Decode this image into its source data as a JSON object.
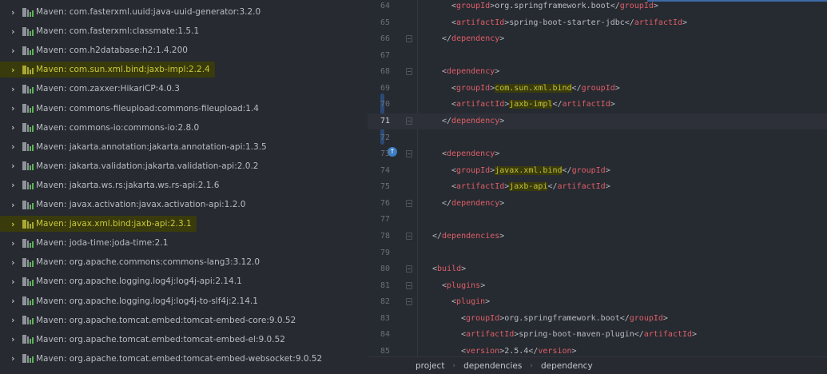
{
  "project_tree": {
    "items": [
      {
        "label": "Maven: com.fasterxml.uuid:java-uuid-generator:3.2.0",
        "highlighted": false
      },
      {
        "label": "Maven: com.fasterxml:classmate:1.5.1",
        "highlighted": false
      },
      {
        "label": "Maven: com.h2database:h2:1.4.200",
        "highlighted": false
      },
      {
        "label": "Maven: com.sun.xml.bind:jaxb-impl:2.2.4",
        "highlighted": true
      },
      {
        "label": "Maven: com.zaxxer:HikariCP:4.0.3",
        "highlighted": false
      },
      {
        "label": "Maven: commons-fileupload:commons-fileupload:1.4",
        "highlighted": false
      },
      {
        "label": "Maven: commons-io:commons-io:2.8.0",
        "highlighted": false
      },
      {
        "label": "Maven: jakarta.annotation:jakarta.annotation-api:1.3.5",
        "highlighted": false
      },
      {
        "label": "Maven: jakarta.validation:jakarta.validation-api:2.0.2",
        "highlighted": false
      },
      {
        "label": "Maven: jakarta.ws.rs:jakarta.ws.rs-api:2.1.6",
        "highlighted": false
      },
      {
        "label": "Maven: javax.activation:javax.activation-api:1.2.0",
        "highlighted": false
      },
      {
        "label": "Maven: javax.xml.bind:jaxb-api:2.3.1",
        "highlighted": true
      },
      {
        "label": "Maven: joda-time:joda-time:2.1",
        "highlighted": false
      },
      {
        "label": "Maven: org.apache.commons:commons-lang3:3.12.0",
        "highlighted": false
      },
      {
        "label": "Maven: org.apache.logging.log4j:log4j-api:2.14.1",
        "highlighted": false
      },
      {
        "label": "Maven: org.apache.logging.log4j:log4j-to-slf4j:2.14.1",
        "highlighted": false
      },
      {
        "label": "Maven: org.apache.tomcat.embed:tomcat-embed-core:9.0.52",
        "highlighted": false
      },
      {
        "label": "Maven: org.apache.tomcat.embed:tomcat-embed-el:9.0.52",
        "highlighted": false
      },
      {
        "label": "Maven: org.apache.tomcat.embed:tomcat-embed-websocket:9.0.52",
        "highlighted": false
      }
    ]
  },
  "editor": {
    "current_line": 71,
    "lines": [
      {
        "n": "64",
        "indent": 3,
        "fold": false,
        "seg": [
          [
            "p",
            "<"
          ],
          [
            "n",
            "groupId"
          ],
          [
            "p",
            ">"
          ],
          [
            "x",
            "org.springframework.boot"
          ],
          [
            "p",
            "</"
          ],
          [
            "n",
            "groupId"
          ],
          [
            "p",
            ">"
          ]
        ]
      },
      {
        "n": "65",
        "indent": 3,
        "fold": false,
        "seg": [
          [
            "p",
            "<"
          ],
          [
            "n",
            "artifactId"
          ],
          [
            "p",
            ">"
          ],
          [
            "x",
            "spring-boot-starter-jdbc"
          ],
          [
            "p",
            "</"
          ],
          [
            "n",
            "artifactId"
          ],
          [
            "p",
            ">"
          ]
        ]
      },
      {
        "n": "66",
        "indent": 2,
        "fold": true,
        "seg": [
          [
            "p",
            "</"
          ],
          [
            "n",
            "dependency"
          ],
          [
            "p",
            ">"
          ]
        ]
      },
      {
        "n": "67",
        "indent": 0,
        "fold": false,
        "seg": []
      },
      {
        "n": "68",
        "indent": 2,
        "fold": true,
        "seg": [
          [
            "p",
            "<"
          ],
          [
            "n",
            "dependency"
          ],
          [
            "p",
            ">"
          ]
        ]
      },
      {
        "n": "69",
        "indent": 3,
        "fold": false,
        "seg": [
          [
            "p",
            "<"
          ],
          [
            "n",
            "groupId"
          ],
          [
            "p",
            ">"
          ],
          [
            "h",
            "com.sun.xml.bind"
          ],
          [
            "p",
            "</"
          ],
          [
            "n",
            "groupId"
          ],
          [
            "p",
            ">"
          ]
        ]
      },
      {
        "n": "70",
        "indent": 3,
        "fold": false,
        "seg": [
          [
            "p",
            "<"
          ],
          [
            "n",
            "artifactId"
          ],
          [
            "p",
            ">"
          ],
          [
            "h",
            "jaxb-impl"
          ],
          [
            "p",
            "</"
          ],
          [
            "n",
            "artifactId"
          ],
          [
            "p",
            ">"
          ]
        ]
      },
      {
        "n": "71",
        "indent": 2,
        "fold": true,
        "seg": [
          [
            "p",
            "</"
          ],
          [
            "n",
            "dependency"
          ],
          [
            "p",
            ">"
          ]
        ]
      },
      {
        "n": "72",
        "indent": 0,
        "fold": false,
        "seg": []
      },
      {
        "n": "73",
        "indent": 2,
        "fold": true,
        "seg": [
          [
            "p",
            "<"
          ],
          [
            "n",
            "dependency"
          ],
          [
            "p",
            ">"
          ]
        ]
      },
      {
        "n": "74",
        "indent": 3,
        "fold": false,
        "seg": [
          [
            "p",
            "<"
          ],
          [
            "n",
            "groupId"
          ],
          [
            "p",
            ">"
          ],
          [
            "h",
            "javax.xml.bind"
          ],
          [
            "p",
            "</"
          ],
          [
            "n",
            "groupId"
          ],
          [
            "p",
            ">"
          ]
        ]
      },
      {
        "n": "75",
        "indent": 3,
        "fold": false,
        "seg": [
          [
            "p",
            "<"
          ],
          [
            "n",
            "artifactId"
          ],
          [
            "p",
            ">"
          ],
          [
            "h",
            "jaxb-api"
          ],
          [
            "p",
            "</"
          ],
          [
            "n",
            "artifactId"
          ],
          [
            "p",
            ">"
          ]
        ]
      },
      {
        "n": "76",
        "indent": 2,
        "fold": true,
        "seg": [
          [
            "p",
            "</"
          ],
          [
            "n",
            "dependency"
          ],
          [
            "p",
            ">"
          ]
        ]
      },
      {
        "n": "77",
        "indent": 0,
        "fold": false,
        "seg": []
      },
      {
        "n": "78",
        "indent": 1,
        "fold": true,
        "seg": [
          [
            "p",
            "</"
          ],
          [
            "n",
            "dependencies"
          ],
          [
            "p",
            ">"
          ]
        ]
      },
      {
        "n": "79",
        "indent": 0,
        "fold": false,
        "seg": []
      },
      {
        "n": "80",
        "indent": 1,
        "fold": true,
        "seg": [
          [
            "p",
            "<"
          ],
          [
            "n",
            "build"
          ],
          [
            "p",
            ">"
          ]
        ]
      },
      {
        "n": "81",
        "indent": 2,
        "fold": true,
        "seg": [
          [
            "p",
            "<"
          ],
          [
            "n",
            "plugins"
          ],
          [
            "p",
            ">"
          ]
        ]
      },
      {
        "n": "82",
        "indent": 3,
        "fold": true,
        "seg": [
          [
            "p",
            "<"
          ],
          [
            "n",
            "plugin"
          ],
          [
            "p",
            ">"
          ]
        ]
      },
      {
        "n": "83",
        "indent": 4,
        "fold": false,
        "seg": [
          [
            "p",
            "<"
          ],
          [
            "n",
            "groupId"
          ],
          [
            "p",
            ">"
          ],
          [
            "x",
            "org.springframework.boot"
          ],
          [
            "p",
            "</"
          ],
          [
            "n",
            "groupId"
          ],
          [
            "p",
            ">"
          ]
        ]
      },
      {
        "n": "84",
        "indent": 4,
        "fold": false,
        "seg": [
          [
            "p",
            "<"
          ],
          [
            "n",
            "artifactId"
          ],
          [
            "p",
            ">"
          ],
          [
            "x",
            "spring-boot-maven-plugin"
          ],
          [
            "p",
            "</"
          ],
          [
            "n",
            "artifactId"
          ],
          [
            "p",
            ">"
          ]
        ]
      },
      {
        "n": "85",
        "indent": 4,
        "fold": false,
        "seg": [
          [
            "p",
            "<"
          ],
          [
            "n",
            "version"
          ],
          [
            "p",
            ">"
          ],
          [
            "x",
            "2.5.4"
          ],
          [
            "p",
            "</"
          ],
          [
            "n",
            "version"
          ],
          [
            "p",
            ">"
          ]
        ]
      }
    ]
  },
  "breadcrumbs": [
    "project",
    "dependencies",
    "dependency"
  ]
}
